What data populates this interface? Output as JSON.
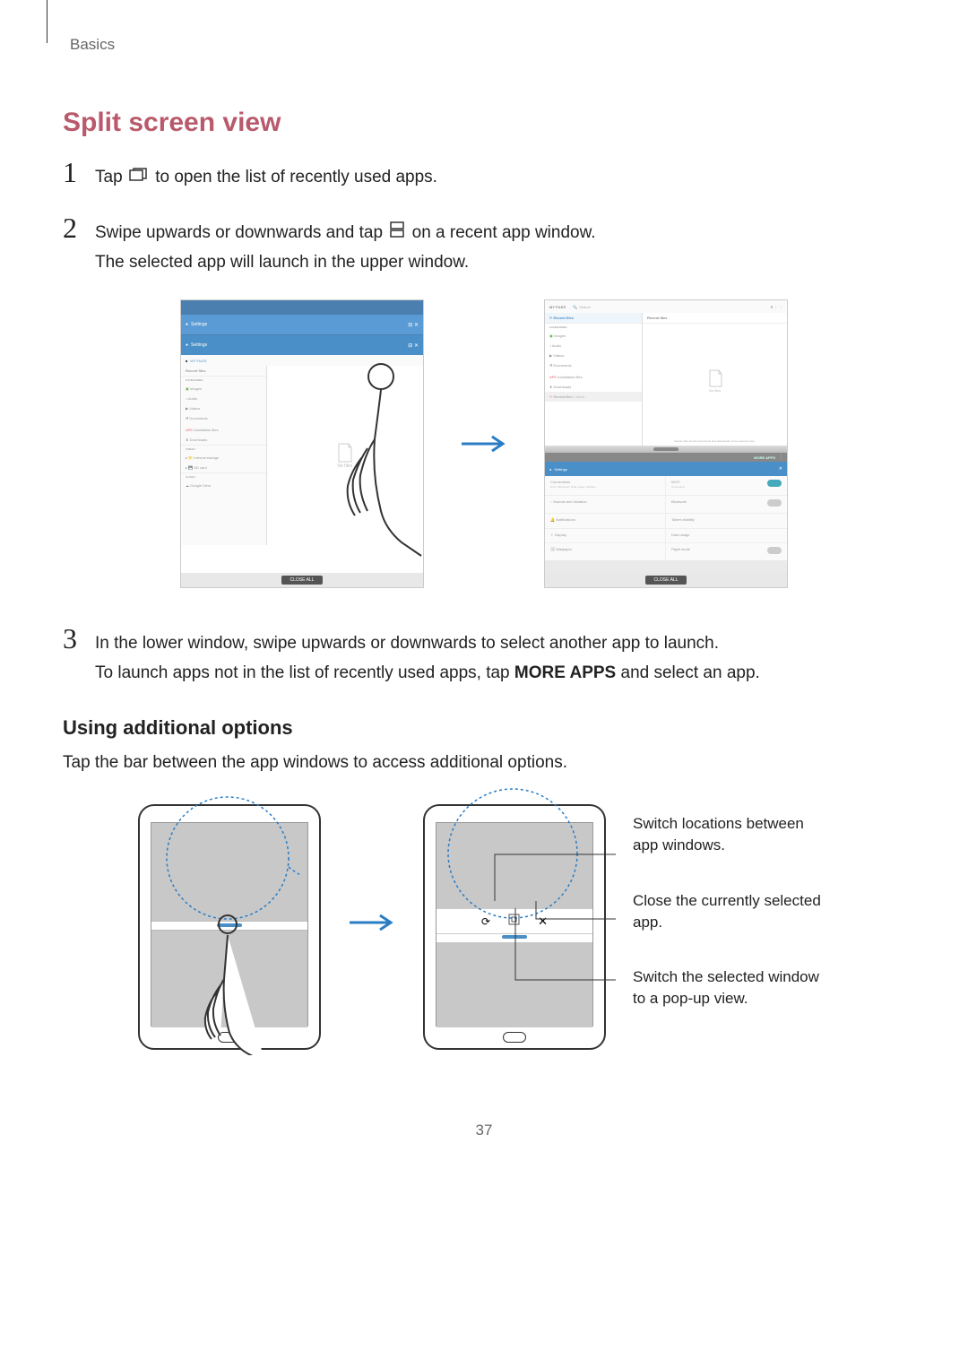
{
  "breadcrumb": "Basics",
  "title": "Split screen view",
  "steps": [
    {
      "num": "1",
      "pre": "Tap ",
      "post": " to open the list of recently used apps."
    },
    {
      "num": "2",
      "line1_pre": "Swipe upwards or downwards and tap ",
      "line1_post": " on a recent app window.",
      "line2": "The selected app will launch in the upper window."
    },
    {
      "num": "3",
      "line1": "In the lower window, swipe upwards or downwards to select another app to launch.",
      "line2_pre": "To launch apps not in the list of recently used apps, tap ",
      "line2_bold": "MORE APPS",
      "line2_post": " and select an app."
    }
  ],
  "subheading": "Using additional options",
  "subtext": "Tap the bar between the app windows to access additional options.",
  "annotations": {
    "switch_loc": "Switch locations between app windows.",
    "close": "Close the currently selected app.",
    "popup": "Switch the selected window to a pop-up view."
  },
  "page_number": "37",
  "screenshot_labels": {
    "my_files": "MY FILES",
    "search": "Search",
    "recent_files": "Recent files",
    "images": "Images",
    "audio": "Audio",
    "videos": "Videos",
    "documents": "Documents",
    "installation_files": "Installation files",
    "downloads": "Downloads",
    "close_all": "CLOSE ALL",
    "more_apps": "MORE APPS",
    "samsung": "SAMSUNG",
    "internal": "Internal storage",
    "sdcard": "SD card",
    "google_drive": "Google Drive",
    "settings": "Settings",
    "no_files": "No files"
  }
}
